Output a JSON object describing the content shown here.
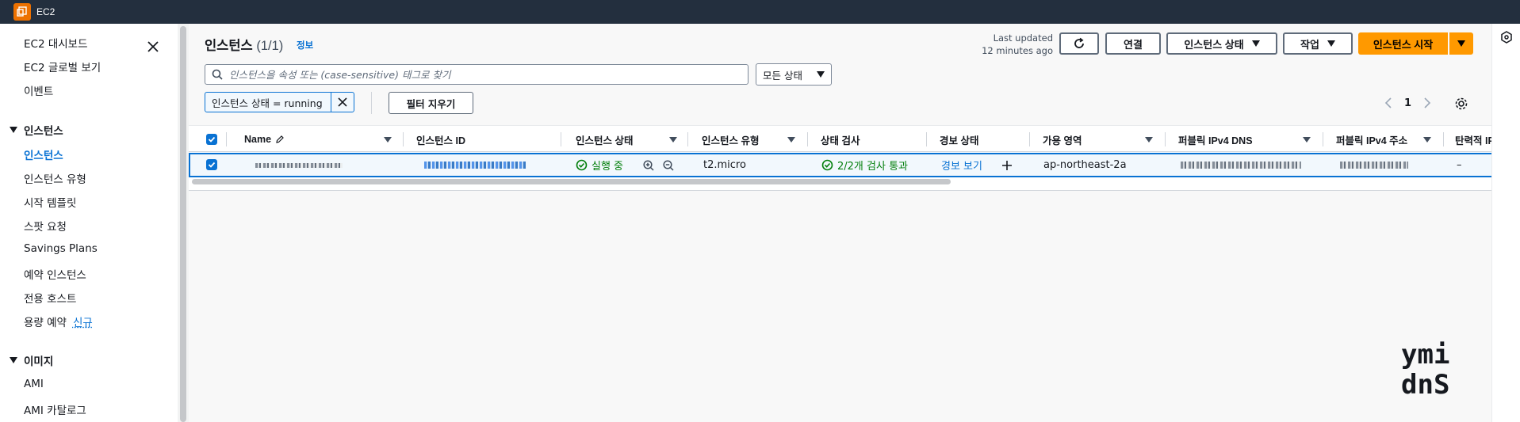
{
  "service": {
    "name": "EC2"
  },
  "sidebar": {
    "items": [
      {
        "label": "EC2 대시보드"
      },
      {
        "label": "EC2 글로벌 보기"
      },
      {
        "label": "이벤트"
      }
    ],
    "sections": [
      {
        "title": "인스턴스",
        "items": [
          {
            "label": "인스턴스",
            "active": true
          },
          {
            "label": "인스턴스 유형"
          },
          {
            "label": "시작 템플릿"
          },
          {
            "label": "스팟 요청"
          },
          {
            "label": "Savings Plans"
          },
          {
            "label": "예약 인스턴스"
          },
          {
            "label": "전용 호스트"
          },
          {
            "label": "용량 예약",
            "badge": "신규"
          }
        ]
      },
      {
        "title": "이미지",
        "items": [
          {
            "label": "AMI"
          },
          {
            "label": "AMI 카탈로그"
          }
        ]
      }
    ]
  },
  "header": {
    "title": "인스턴스",
    "count": "(1/1)",
    "info": "정보",
    "last_updated_line1": "Last updated",
    "last_updated_line2": "12 minutes ago",
    "connect": "연결",
    "instance_state": "인스턴스 상태",
    "actions": "작업",
    "launch": "인스턴스 시작"
  },
  "filters": {
    "search_placeholder": "인스턴스을 속성 또는 (case-sensitive) 태그로 찾기",
    "status_select": "모든 상태",
    "token": "인스턴스 상태 = running",
    "clear": "필터 지우기"
  },
  "pagination": {
    "page": "1"
  },
  "table": {
    "columns": [
      "Name",
      "인스턴스 ID",
      "인스턴스 상태",
      "인스턴스 유형",
      "상태 검사",
      "경보 상태",
      "가용 영역",
      "퍼블릭 IPv4 DNS",
      "퍼블릭 IPv4 주소",
      "탄력적 IP"
    ],
    "row": {
      "state": "실행 중",
      "type": "t2.micro",
      "status_check": "2/2개 검사 통과",
      "alarm": "경보 보기",
      "az": "ap-northeast-2a",
      "elastic_ip": "–"
    }
  },
  "watermark": {
    "line1": "ymi",
    "line2": "dnS"
  },
  "colors": {
    "accent": "#0972d3",
    "primary": "#ff9900",
    "success": "#037f0c",
    "topbar": "#232f3e"
  }
}
